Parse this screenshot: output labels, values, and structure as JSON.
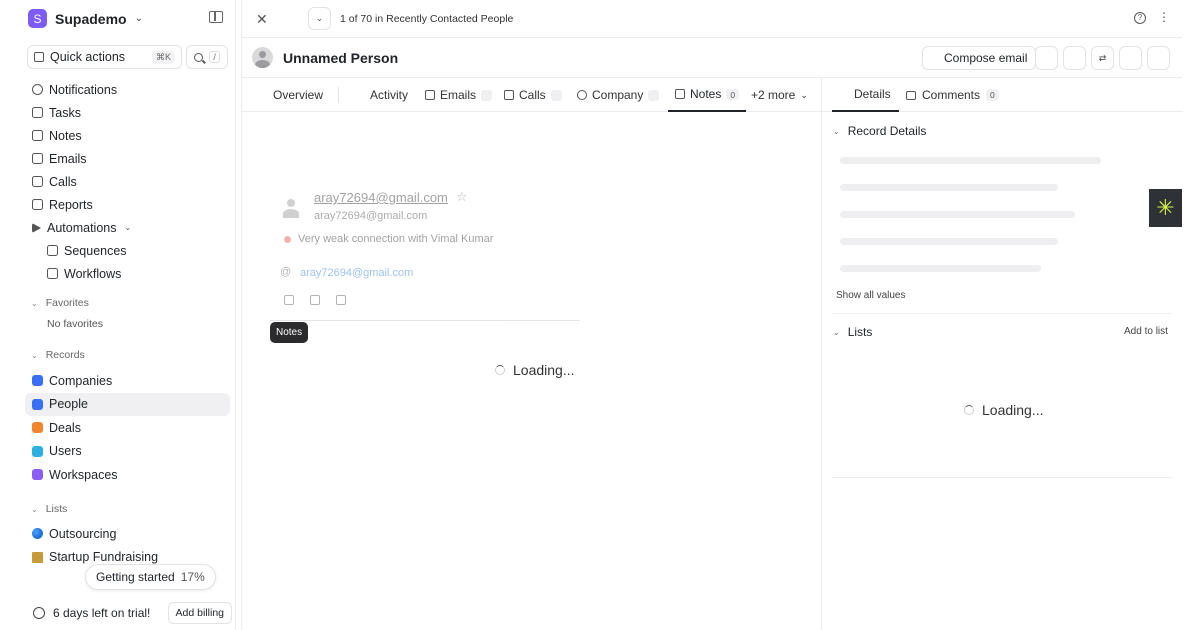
{
  "workspace": {
    "initial": "S",
    "name": "Supademo"
  },
  "sidebar": {
    "quick_actions": {
      "label": "Quick actions",
      "shortcut": "⌘K"
    },
    "search_shortcut": "/",
    "nav": [
      {
        "label": "Notifications"
      },
      {
        "label": "Tasks"
      },
      {
        "label": "Notes"
      },
      {
        "label": "Emails"
      },
      {
        "label": "Calls"
      },
      {
        "label": "Reports"
      },
      {
        "label": "Automations"
      },
      {
        "label": "Sequences"
      },
      {
        "label": "Workflows"
      }
    ],
    "favorites": {
      "title": "Favorites",
      "empty": "No favorites"
    },
    "records": {
      "title": "Records",
      "items": [
        {
          "label": "Companies",
          "color": "#3b6ff5"
        },
        {
          "label": "People",
          "color": "#3b6ff5"
        },
        {
          "label": "Deals",
          "color": "#f0852d"
        },
        {
          "label": "Users",
          "color": "#2ab1e0"
        },
        {
          "label": "Workspaces",
          "color": "#8b5cf6"
        }
      ]
    },
    "lists": {
      "title": "Lists",
      "items": [
        {
          "label": "Outsourcing"
        },
        {
          "label": "Startup Fundraising"
        }
      ]
    },
    "getting_started": {
      "label": "Getting started",
      "percent": "17%"
    },
    "trial": {
      "label": "6 days left on trial!",
      "billing": "Add billing"
    }
  },
  "topbar": {
    "crumb": "1 of 70 in Recently Contacted People"
  },
  "record": {
    "name": "Unnamed Person",
    "compose_label": "Compose email"
  },
  "tabs": {
    "overview": "Overview",
    "activity": "Activity",
    "emails": "Emails",
    "calls": "Calls",
    "company": "Company",
    "notes": "Notes",
    "notes_count": "0",
    "more": "+2 more"
  },
  "person_card": {
    "email_title": "aray72694@gmail.com",
    "email_sub": "aray72694@gmail.com",
    "connection": "Very weak connection with Vimal Kumar",
    "email_link": "aray72694@gmail.com"
  },
  "tooltip": "Notes",
  "main_loading": "Loading...",
  "right_panel": {
    "tab_details": "Details",
    "tab_comments": "Comments",
    "comments_count": "0",
    "record_details": "Record Details",
    "show_all": "Show all values",
    "lists_title": "Lists",
    "add_to_list": "Add to list",
    "loading": "Loading..."
  }
}
